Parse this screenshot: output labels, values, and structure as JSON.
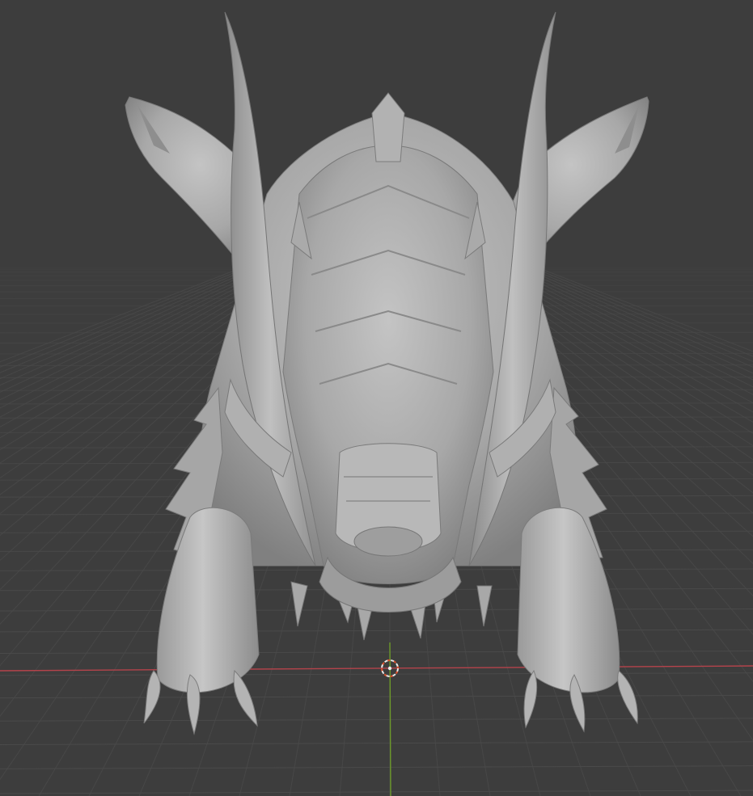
{
  "viewport": {
    "background_color": "#3d3d3d",
    "grid_color": "#4a4a4a",
    "x_axis_color": "#b5434b",
    "y_axis_color": "#6d9a2a",
    "model_color": "#a9a9a9",
    "cursor_color": "#e8e8e8",
    "cursor_accent_color": "#e0502c"
  },
  "model": {
    "name_icon": "dragon-sculpt-model"
  },
  "cursor": {
    "icon": "3d-cursor-icon"
  }
}
